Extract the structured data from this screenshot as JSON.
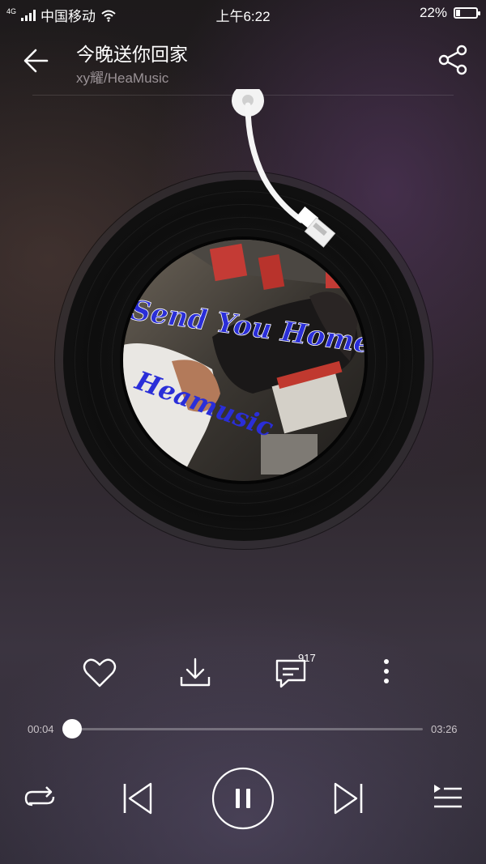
{
  "status_bar": {
    "network": "4G",
    "carrier": "中国移动",
    "time": "上午6:22",
    "battery_text": "22%",
    "battery_level": 0.22
  },
  "header": {
    "back_icon": "arrow-left-icon",
    "title": "今晚送你回家",
    "subtitle": "xy耀/HeaMusic",
    "share_icon": "share-icon"
  },
  "disc": {
    "cover_text": "Send You Home Tonight",
    "cover_brand": "Heamusic"
  },
  "actions": {
    "like_icon": "heart-icon",
    "download_icon": "download-icon",
    "comment_icon": "comment-icon",
    "comment_count": "917",
    "more_icon": "more-vertical-icon"
  },
  "progress": {
    "current": "00:04",
    "total": "03:26",
    "fraction": 0.02
  },
  "controls": {
    "repeat_icon": "repeat-icon",
    "prev_icon": "previous-icon",
    "play_pause_icon": "pause-icon",
    "next_icon": "next-icon",
    "playlist_icon": "playlist-icon"
  },
  "colors": {
    "accent": "#ffffff",
    "muted_text": "#9a9296"
  }
}
